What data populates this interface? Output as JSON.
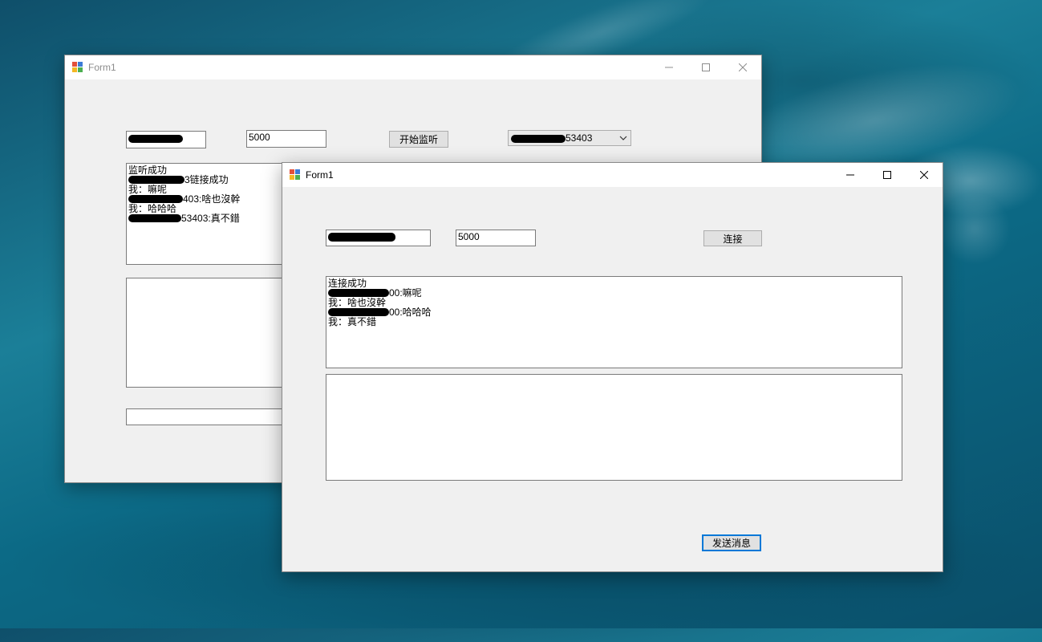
{
  "back_window": {
    "title": "Form1",
    "ip_field_suffix": "",
    "port_value": "5000",
    "listen_button_label": "开始监听",
    "client_combo_suffix": "53403",
    "log_lines": [
      {
        "text": "监听成功"
      },
      {
        "text": "3链接成功"
      },
      {
        "text": "我：嘛呢"
      },
      {
        "text": "403:啥也沒幹"
      },
      {
        "text": "我：哈哈哈"
      },
      {
        "text": "53403:真不錯"
      }
    ]
  },
  "front_window": {
    "title": "Form1",
    "port_value": "5000",
    "connect_button_label": "连接",
    "send_button_label": "发送消息",
    "log_lines": [
      {
        "text": "连接成功"
      },
      {
        "text": "00:嘛呢"
      },
      {
        "text": "我：啥也沒幹"
      },
      {
        "text": "00:哈哈哈"
      },
      {
        "text": "我：真不錯"
      }
    ],
    "message_input_value": ""
  },
  "icons": {
    "minimize": "minimize-icon",
    "maximize": "maximize-icon",
    "close": "close-icon",
    "app": "winforms-app-icon",
    "dropdown": "chevron-down-icon"
  },
  "colors": {
    "window_bg": "#f0f0f0",
    "titlebar_bg": "#ffffff",
    "default_button_border": "#0078d7",
    "inactive_title": "#8c8c8c"
  }
}
